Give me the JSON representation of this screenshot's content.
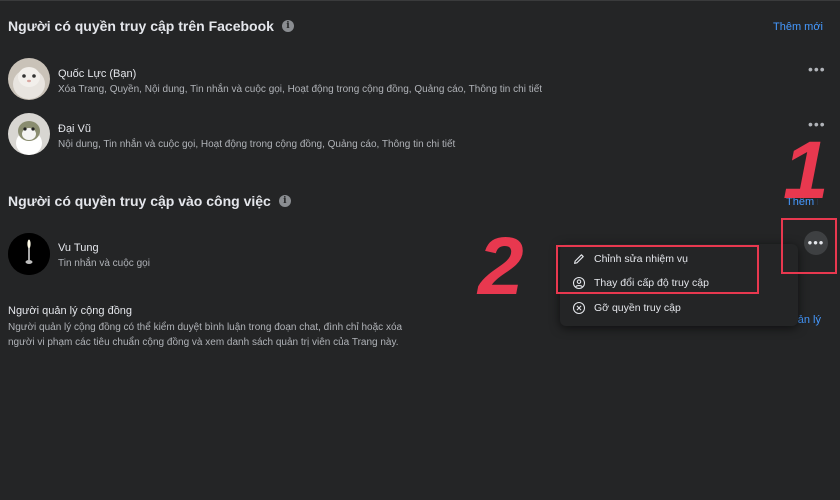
{
  "sections": {
    "facebook": {
      "title": "Người có quyền truy cập trên Facebook",
      "add_link": "Thêm mới",
      "people": [
        {
          "name": "Quốc Lực (Bạn)",
          "permissions": "Xóa Trang, Quyền, Nội dung, Tin nhắn và cuộc gọi, Hoạt động trong cộng đồng, Quảng cáo, Thông tin chi tiết"
        },
        {
          "name": "Đại Vũ",
          "permissions": "Nội dung, Tin nhắn và cuộc gọi, Hoạt động trong cộng đồng, Quảng cáo, Thông tin chi tiết"
        }
      ]
    },
    "work": {
      "title": "Người có quyền truy cập vào công việc",
      "add_link": "Thêm mới",
      "people": [
        {
          "name": "Vu Tung",
          "permissions": "Tin nhắn và cuộc gọi"
        }
      ]
    },
    "community": {
      "title": "Người quản lý cộng đồng",
      "description_line1": "Người quản lý cộng đồng có thể kiểm duyệt bình luận trong đoạn chat, đình chỉ hoặc xóa",
      "description_line2": "người vi phạm các tiêu chuẩn cộng đồng và xem danh sách quản trị viên của Trang này.",
      "manage_link": "Quản lý"
    }
  },
  "menu": {
    "items": [
      {
        "label": "Chỉnh sửa nhiệm vụ",
        "icon": "pencil-icon"
      },
      {
        "label": "Thay đổi cấp độ truy cập",
        "icon": "user-circle-icon"
      },
      {
        "label": "Gỡ quyền truy cập",
        "icon": "close-circle-icon"
      }
    ]
  },
  "annotations": {
    "step1": "1",
    "step2": "2"
  },
  "more_glyph": "•••",
  "colors": {
    "background": "#242526",
    "link": "#4599ff",
    "annotation": "#e8384f",
    "text_secondary": "#b0b3b8"
  }
}
